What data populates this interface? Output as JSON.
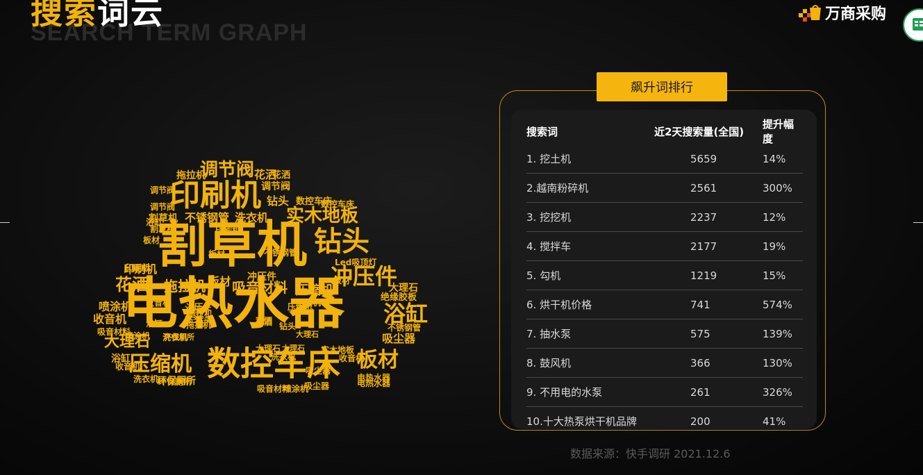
{
  "header": {
    "title_part1": "搜索",
    "title_part2": "词云",
    "subtitle_en": "SEARCH TERM GRAPH"
  },
  "brand": {
    "name": "万商采购",
    "logo_icon": "flag-bag-logo-icon"
  },
  "corner_button_icon": "spreadsheet-grid-icon",
  "colors": {
    "accent": "#f3b30c",
    "background": "#0b0b0b",
    "card": "#1b1b1b"
  },
  "word_cloud": {
    "words": [
      "电热水器",
      "割草机",
      "数控车床",
      "压缩机",
      "钻头",
      "印刷机",
      "冲压件",
      "浴缸",
      "板材",
      "调节阀",
      "实木地板",
      "花洒",
      "拖拉机",
      "大理石",
      "吸音材料",
      "不锈钢管",
      "洗衣机",
      "喷涂机",
      "收音机",
      "吸尘器",
      "环保厕所",
      "绝缘胶板",
      "Led吸顶灯",
      "割草机",
      "不锈钢管",
      "洗衣机",
      "印刷机",
      "调节阀",
      "钻头",
      "花洒",
      "拖拉机",
      "板材",
      "吸音材料",
      "冲压件",
      "压缩机",
      "大理石",
      "收音机",
      "吸尘器",
      "浴缸",
      "板材",
      "环保厕所",
      "洗衣机",
      "数控车床",
      "电热水器",
      "压缩机",
      "大理石",
      "花洒",
      "吸音材料",
      "喷涂机",
      "收音机",
      "钻头",
      "拖拉机",
      "浴缸",
      "板材",
      "花洒",
      "冲压件",
      "印刷机",
      "调节阀",
      "数控车床",
      "浴缸",
      "吸尘器",
      "钻头",
      "冲压件",
      "大理石",
      "洗衣机",
      "电热水器",
      "压缩机",
      "喷涂机",
      "花洒",
      "板材",
      "调节阀",
      "印刷机",
      "割草机",
      "不锈钢管",
      "拖拉机",
      "实木地板",
      "收音机",
      "环保厕所",
      "钻头",
      "大理石"
    ]
  },
  "ranking": {
    "badge": "飙升词排行",
    "headers": [
      "搜索词",
      "近2天搜索量(全国)",
      "提升幅度"
    ],
    "rows": [
      [
        "1. 挖土机",
        "5659",
        "14%"
      ],
      [
        "2.越南粉碎机",
        "2561",
        "300%"
      ],
      [
        "3. 挖挖机",
        "2237",
        "12%"
      ],
      [
        "4. 搅拌车",
        "2177",
        "19%"
      ],
      [
        "5. 勾机",
        "1219",
        "15%"
      ],
      [
        "6. 烘干机价格",
        "741",
        "574%"
      ],
      [
        "7. 抽水泵",
        "575",
        "139%"
      ],
      [
        "8. 鼓风机",
        "366",
        "130%"
      ],
      [
        "9. 不用电的水泵",
        "261",
        "326%"
      ],
      [
        "10.十大热泵烘干机品牌",
        "200",
        "41%"
      ]
    ]
  },
  "footer": {
    "source": "数据来源：快手调研 2021.12.6"
  }
}
